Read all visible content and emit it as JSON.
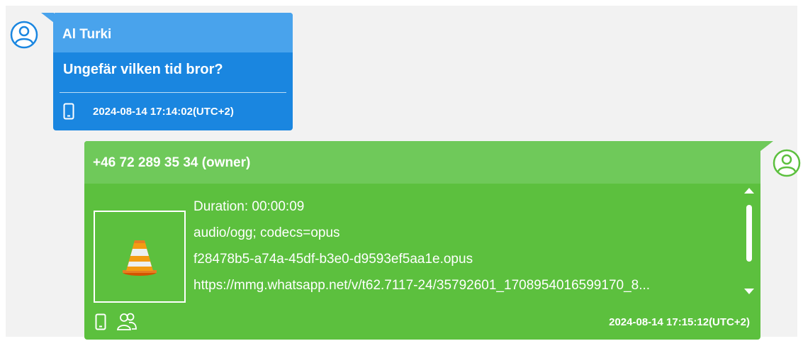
{
  "incoming": {
    "sender": "Al Turki",
    "text": "Ungefär vilken tid bror?",
    "timestamp": "2024-08-14 17:14:02(UTC+2)",
    "icons": {
      "avatar": "user-avatar-icon",
      "device": "phone-icon"
    },
    "colors": {
      "header": "#49a3ec",
      "body": "#1a86e0",
      "avatar": "#1a86e0"
    }
  },
  "outgoing": {
    "sender": "+46 72 289 35 34 (owner)",
    "attachment": {
      "duration": "Duration: 00:00:09",
      "mime": "audio/ogg; codecs=opus",
      "filename": "f28478b5-a74a-45df-b3e0-d9593ef5aa1e.opus",
      "url": "https://mmg.whatsapp.net/v/t62.7117-24/35792601_1708954016599170_8...",
      "thumbnail_icon": "vlc-cone-icon"
    },
    "timestamp": "2024-08-14 17:15:12(UTC+2)",
    "icons": {
      "avatar": "user-avatar-icon",
      "device": "phone-icon",
      "group": "group-icon"
    },
    "colors": {
      "header": "#6fc95a",
      "body": "#5cc03e",
      "avatar": "#5cc03e"
    }
  }
}
